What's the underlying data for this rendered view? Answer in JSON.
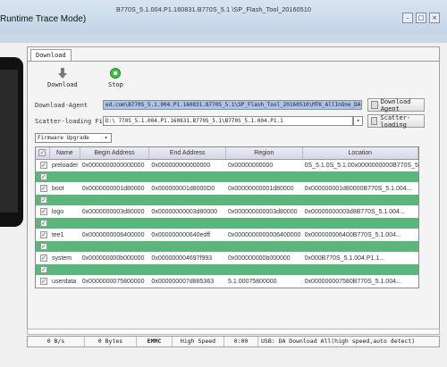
{
  "window": {
    "title": "Runtime Trace Mode)",
    "flash_tool_path": "B770S_5.1.004.P1.160831.B770S_5.1 \\SP_Flash_Tool_20160510"
  },
  "tabs": [
    "Download"
  ],
  "toolbar": {
    "download_label": "Download",
    "stop_label": "Stop"
  },
  "download_agent": {
    "label": "Download-Agent",
    "value": "ed.com\\B770S_5.1.004.P1.160831.B770S_5.1\\SP_Flash_Tool_20160510\\MTK_AllInOne_DA.bin",
    "button": "Download Agent"
  },
  "scatter": {
    "label": "Scatter-loading File",
    "value": "D:\\                           770S_5.1.004.P1.160831.B770S_5.1\\B770S_5.1.004.P1.1",
    "button": "Scatter-loading"
  },
  "mode_select": {
    "value": "Firmware Upgrade"
  },
  "table": {
    "headers": [
      "",
      "Name",
      "Begin Address",
      "End Address",
      "Region",
      "Location"
    ],
    "rows": [
      {
        "style": "white",
        "name": "preloader",
        "begin": "0x0000000000000000",
        "end": "0x000000000000000",
        "region": "0x00000000000",
        "location": "0S_5.1.0S_5.1.00x0000000000B770S_5.1.004..."
      },
      {
        "style": "green",
        "name": "",
        "begin": "",
        "end": "",
        "region": "",
        "location": ""
      },
      {
        "style": "white",
        "name": "boot",
        "begin": "0x0000000001d80000",
        "end": "0x000000001d8000D0",
        "region": "0x00000000001d80000",
        "location": "0x000000001d80000B770S_5.1.004..."
      },
      {
        "style": "green",
        "name": "",
        "begin": "",
        "end": "",
        "region": "",
        "location": ""
      },
      {
        "style": "white",
        "name": "logo",
        "begin": "0x0000000003d80000",
        "end": "0x00000000003d80000",
        "region": "0x000000000003d80000",
        "location": "0x00000000003d8B770S_5.1.004..."
      },
      {
        "style": "green",
        "name": "",
        "begin": "",
        "end": "",
        "region": "",
        "location": ""
      },
      {
        "style": "white",
        "name": "tee1",
        "begin": "0x0000000006400000",
        "end": "0x000000000640edff",
        "region": "0x0000000000006400000",
        "location": "0x000000006400B770S_5.1.004..."
      },
      {
        "style": "green",
        "name": "",
        "begin": "",
        "end": "",
        "region": "",
        "location": ""
      },
      {
        "style": "white",
        "name": "system",
        "begin": "0x000000000b000000",
        "end": "0x000000004697f993",
        "region": "0x000000000b000000",
        "location": "0x000B770S_5.1.004.P1.1..."
      },
      {
        "style": "green",
        "name": "",
        "begin": "",
        "end": "",
        "region": "",
        "location": ""
      },
      {
        "style": "white",
        "name": "userdata",
        "begin": "0x0000000075800000",
        "end": "0x000000007d885363",
        "region": "5.1.00075800000",
        "location": "0x000000007580B770S_5.1.004..."
      }
    ]
  },
  "status_bar": {
    "speed": "0 B/s",
    "bytes": "0 Bytes",
    "storage": "EMMC",
    "usb_speed": "High Speed",
    "time": "0:00",
    "message": "USB: DA Download All(high speed,auto detect)"
  }
}
